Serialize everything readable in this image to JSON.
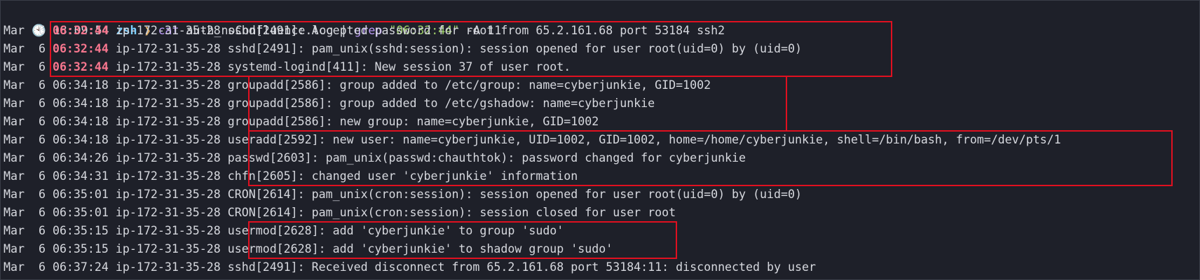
{
  "prompt": {
    "clock_icon": "clock-icon",
    "time": "18:09:54",
    "shell": "zsh",
    "arrow": "❯",
    "cmd_cat": "cat",
    "file": "auth_noConfluence.log",
    "pipe": "|",
    "cmd_grep": "grep",
    "pattern": "\"06:32:44\"",
    "flag": "-A",
    "count": "11"
  },
  "log_lines": [
    {
      "date": "Mar  6",
      "time": "06:32:44",
      "host": "ip-172-31-35-28",
      "msg": "sshd[2491]: Accepted password for root from 65.2.161.68 port 53184 ssh2",
      "highlight_time": true
    },
    {
      "date": "Mar  6",
      "time": "06:32:44",
      "host": "ip-172-31-35-28",
      "msg": "sshd[2491]: pam_unix(sshd:session): session opened for user root(uid=0) by (uid=0)",
      "highlight_time": true
    },
    {
      "date": "Mar  6",
      "time": "06:32:44",
      "host": "ip-172-31-35-28",
      "msg": "systemd-logind[411]: New session 37 of user root.",
      "highlight_time": true
    },
    {
      "date": "Mar  6",
      "time": "06:34:18",
      "host": "ip-172-31-35-28",
      "msg": "groupadd[2586]: group added to /etc/group: name=cyberjunkie, GID=1002",
      "highlight_time": false
    },
    {
      "date": "Mar  6",
      "time": "06:34:18",
      "host": "ip-172-31-35-28",
      "msg": "groupadd[2586]: group added to /etc/gshadow: name=cyberjunkie",
      "highlight_time": false
    },
    {
      "date": "Mar  6",
      "time": "06:34:18",
      "host": "ip-172-31-35-28",
      "msg": "groupadd[2586]: new group: name=cyberjunkie, GID=1002",
      "highlight_time": false
    },
    {
      "date": "Mar  6",
      "time": "06:34:18",
      "host": "ip-172-31-35-28",
      "msg": "useradd[2592]: new user: name=cyberjunkie, UID=1002, GID=1002, home=/home/cyberjunkie, shell=/bin/bash, from=/dev/pts/1",
      "highlight_time": false
    },
    {
      "date": "Mar  6",
      "time": "06:34:26",
      "host": "ip-172-31-35-28",
      "msg": "passwd[2603]: pam_unix(passwd:chauthtok): password changed for cyberjunkie",
      "highlight_time": false
    },
    {
      "date": "Mar  6",
      "time": "06:34:31",
      "host": "ip-172-31-35-28",
      "msg": "chfn[2605]: changed user 'cyberjunkie' information",
      "highlight_time": false
    },
    {
      "date": "Mar  6",
      "time": "06:35:01",
      "host": "ip-172-31-35-28",
      "msg": "CRON[2614]: pam_unix(cron:session): session opened for user root(uid=0) by (uid=0)",
      "highlight_time": false
    },
    {
      "date": "Mar  6",
      "time": "06:35:01",
      "host": "ip-172-31-35-28",
      "msg": "CRON[2614]: pam_unix(cron:session): session closed for user root",
      "highlight_time": false
    },
    {
      "date": "Mar  6",
      "time": "06:35:15",
      "host": "ip-172-31-35-28",
      "msg": "usermod[2628]: add 'cyberjunkie' to group 'sudo'",
      "highlight_time": false
    },
    {
      "date": "Mar  6",
      "time": "06:35:15",
      "host": "ip-172-31-35-28",
      "msg": "usermod[2628]: add 'cyberjunkie' to shadow group 'sudo'",
      "highlight_time": false
    },
    {
      "date": "Mar  6",
      "time": "06:37:24",
      "host": "ip-172-31-35-28",
      "msg": "sshd[2491]: Received disconnect from 65.2.161.68 port 53184:11: disconnected by user",
      "highlight_time": false
    }
  ],
  "colors": {
    "background": "#1e2029",
    "text": "#d6d8de",
    "highlight_time": "#f7768e",
    "annotation_box": "#e01020"
  }
}
